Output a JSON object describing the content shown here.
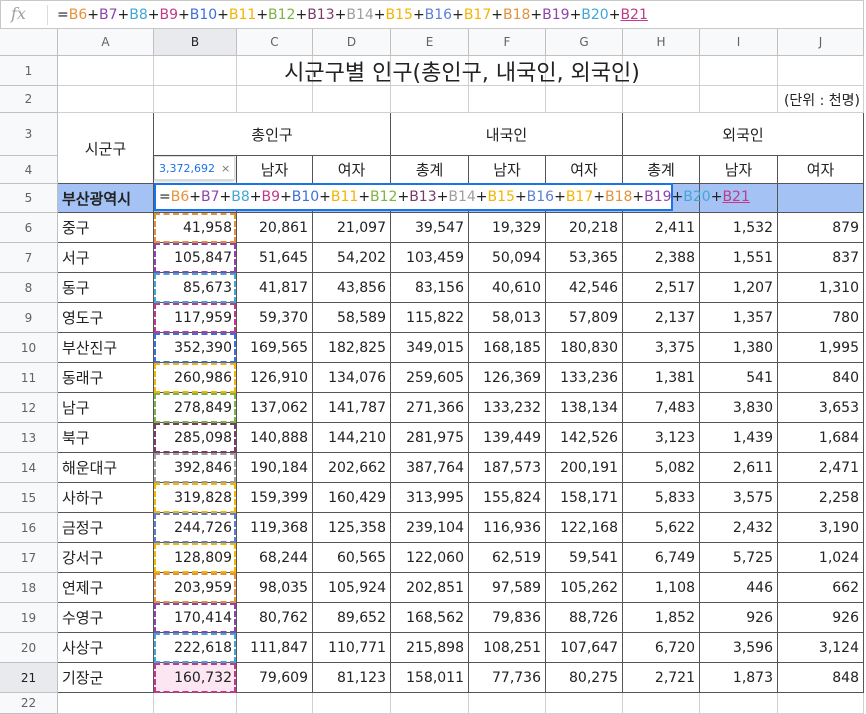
{
  "formula_bar": {
    "fx": "fx",
    "parts": [
      {
        "t": "=",
        "c": "#222222"
      },
      {
        "t": "B6",
        "c": "#e69138"
      },
      {
        "t": "+",
        "c": "#222222"
      },
      {
        "t": "B7",
        "c": "#8e44ad"
      },
      {
        "t": "+",
        "c": "#222222"
      },
      {
        "t": "B8",
        "c": "#3fa7d6"
      },
      {
        "t": "+",
        "c": "#222222"
      },
      {
        "t": "B9",
        "c": "#c0398a"
      },
      {
        "t": "+",
        "c": "#222222"
      },
      {
        "t": "B10",
        "c": "#3d6ee0"
      },
      {
        "t": "+",
        "c": "#222222"
      },
      {
        "t": "B11",
        "c": "#f4b400"
      },
      {
        "t": "+",
        "c": "#222222"
      },
      {
        "t": "B12",
        "c": "#7cb342"
      },
      {
        "t": "+",
        "c": "#222222"
      },
      {
        "t": "B13",
        "c": "#7a3b69"
      },
      {
        "t": "+",
        "c": "#222222"
      },
      {
        "t": "B14",
        "c": "#9e9e9e"
      },
      {
        "t": "+",
        "c": "#222222"
      },
      {
        "t": "B15",
        "c": "#f4b400"
      },
      {
        "t": "+",
        "c": "#222222"
      },
      {
        "t": "B16",
        "c": "#5c7fd6"
      },
      {
        "t": "+",
        "c": "#222222"
      },
      {
        "t": "B17",
        "c": "#f4b400"
      },
      {
        "t": "+",
        "c": "#222222"
      },
      {
        "t": "B18",
        "c": "#e69138"
      },
      {
        "t": "+",
        "c": "#222222"
      },
      {
        "t": "B19",
        "c": "#8e44ad"
      },
      {
        "t": "+",
        "c": "#222222"
      },
      {
        "t": "B20",
        "c": "#3fa7d6"
      },
      {
        "t": "+",
        "c": "#222222"
      },
      {
        "t": "B21",
        "c": "#c0398a",
        "u": true
      }
    ]
  },
  "columns": [
    "A",
    "B",
    "C",
    "D",
    "E",
    "F",
    "G",
    "H",
    "I",
    "J"
  ],
  "selected_column": "B",
  "selected_row": "21",
  "row_numbers": [
    "1",
    "2",
    "3",
    "4",
    "5",
    "6",
    "7",
    "8",
    "9",
    "10",
    "11",
    "12",
    "13",
    "14",
    "15",
    "16",
    "17",
    "18",
    "19",
    "20",
    "21",
    "22"
  ],
  "title": "시군구별 인구(총인구, 내국인, 외국인)",
  "unit": "(단위 : 천명)",
  "header": {
    "sigungu": "시군구",
    "total": "총인구",
    "native": "내국인",
    "foreign": "외국인",
    "sub": [
      "남자",
      "여자",
      "총계",
      "남자",
      "여자",
      "총계",
      "남자",
      "여자"
    ]
  },
  "row5_label": "부산광역시",
  "tooltip": {
    "value": "3,372,692",
    "close": "×"
  },
  "rows": [
    {
      "name": "중구",
      "v": [
        "41,958",
        "20,861",
        "21,097",
        "39,547",
        "19,329",
        "20,218",
        "2,411",
        "1,532",
        "879"
      ]
    },
    {
      "name": "서구",
      "v": [
        "105,847",
        "51,645",
        "54,202",
        "103,459",
        "50,094",
        "53,365",
        "2,388",
        "1,551",
        "837"
      ]
    },
    {
      "name": "동구",
      "v": [
        "85,673",
        "41,817",
        "43,856",
        "83,156",
        "40,610",
        "42,546",
        "2,517",
        "1,207",
        "1,310"
      ]
    },
    {
      "name": "영도구",
      "v": [
        "117,959",
        "59,370",
        "58,589",
        "115,822",
        "58,013",
        "57,809",
        "2,137",
        "1,357",
        "780"
      ]
    },
    {
      "name": "부산진구",
      "v": [
        "352,390",
        "169,565",
        "182,825",
        "349,015",
        "168,185",
        "180,830",
        "3,375",
        "1,380",
        "1,995"
      ]
    },
    {
      "name": "동래구",
      "v": [
        "260,986",
        "126,910",
        "134,076",
        "259,605",
        "126,369",
        "133,236",
        "1,381",
        "541",
        "840"
      ]
    },
    {
      "name": "남구",
      "v": [
        "278,849",
        "137,062",
        "141,787",
        "271,366",
        "133,232",
        "138,134",
        "7,483",
        "3,830",
        "3,653"
      ]
    },
    {
      "name": "북구",
      "v": [
        "285,098",
        "140,888",
        "144,210",
        "281,975",
        "139,449",
        "142,526",
        "3,123",
        "1,439",
        "1,684"
      ]
    },
    {
      "name": "해운대구",
      "v": [
        "392,846",
        "190,184",
        "202,662",
        "387,764",
        "187,573",
        "200,191",
        "5,082",
        "2,611",
        "2,471"
      ]
    },
    {
      "name": "사하구",
      "v": [
        "319,828",
        "159,399",
        "160,429",
        "313,995",
        "155,824",
        "158,171",
        "5,833",
        "3,575",
        "2,258"
      ]
    },
    {
      "name": "금정구",
      "v": [
        "244,726",
        "119,368",
        "125,358",
        "239,104",
        "116,936",
        "122,168",
        "5,622",
        "2,432",
        "3,190"
      ]
    },
    {
      "name": "강서구",
      "v": [
        "128,809",
        "68,244",
        "60,565",
        "122,060",
        "62,519",
        "59,541",
        "6,749",
        "5,725",
        "1,024"
      ]
    },
    {
      "name": "연제구",
      "v": [
        "203,959",
        "98,035",
        "105,924",
        "202,851",
        "97,589",
        "105,262",
        "1,108",
        "446",
        "662"
      ]
    },
    {
      "name": "수영구",
      "v": [
        "170,414",
        "80,762",
        "89,652",
        "168,562",
        "79,836",
        "88,726",
        "1,852",
        "926",
        "926"
      ]
    },
    {
      "name": "사상구",
      "v": [
        "222,618",
        "111,847",
        "110,771",
        "215,898",
        "108,251",
        "107,647",
        "6,720",
        "3,596",
        "3,124"
      ]
    },
    {
      "name": "기장군",
      "v": [
        "160,732",
        "79,609",
        "81,123",
        "158,011",
        "77,736",
        "80,275",
        "2,721",
        "1,873",
        "848"
      ]
    }
  ]
}
